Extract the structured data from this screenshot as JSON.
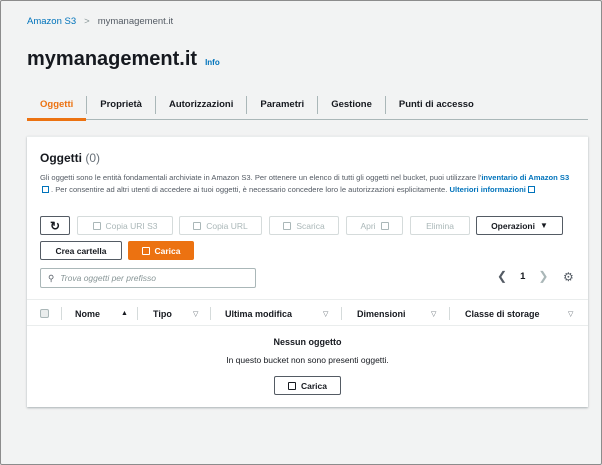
{
  "breadcrumb": {
    "root": "Amazon S3",
    "current": "mymanagement.it"
  },
  "page": {
    "title": "mymanagement.it",
    "info": "Info"
  },
  "tabs": [
    "Oggetti",
    "Proprietà",
    "Autorizzazioni",
    "Parametri",
    "Gestione",
    "Punti di accesso"
  ],
  "panel": {
    "title": "Oggetti",
    "count": "(0)",
    "desc1": "Gli oggetti sono le entità fondamentali archiviate in Amazon S3. Per ottenere un elenco di tutti gli oggetti nel bucket, puoi utilizzare l'",
    "link1": "inventario di Amazon S3",
    "desc2": ". Per consentire ad altri utenti di accedere ai tuoi oggetti, è necessario concedere loro le autorizzazioni esplicitamente.",
    "link2": "Ulteriori informazioni"
  },
  "toolbar": {
    "refresh_icon": "↻",
    "copy_s3_uri": "Copia URI S3",
    "copy_url": "Copia URL",
    "download": "Scarica",
    "open": "Apri",
    "delete": "Elimina",
    "actions": "Operazioni",
    "create_folder": "Crea cartella",
    "upload": "Carica"
  },
  "search": {
    "placeholder": "Trova oggetti per prefisso"
  },
  "pager": {
    "page": "1"
  },
  "table": {
    "columns": [
      "Nome",
      "Tipo",
      "Ultima modifica",
      "Dimensioni",
      "Classe di storage"
    ]
  },
  "empty": {
    "title": "Nessun oggetto",
    "desc": "In questo bucket non sono presenti oggetti.",
    "upload": "Carica"
  },
  "colors": {
    "accent": "#ec7211",
    "link": "#0073bb"
  }
}
